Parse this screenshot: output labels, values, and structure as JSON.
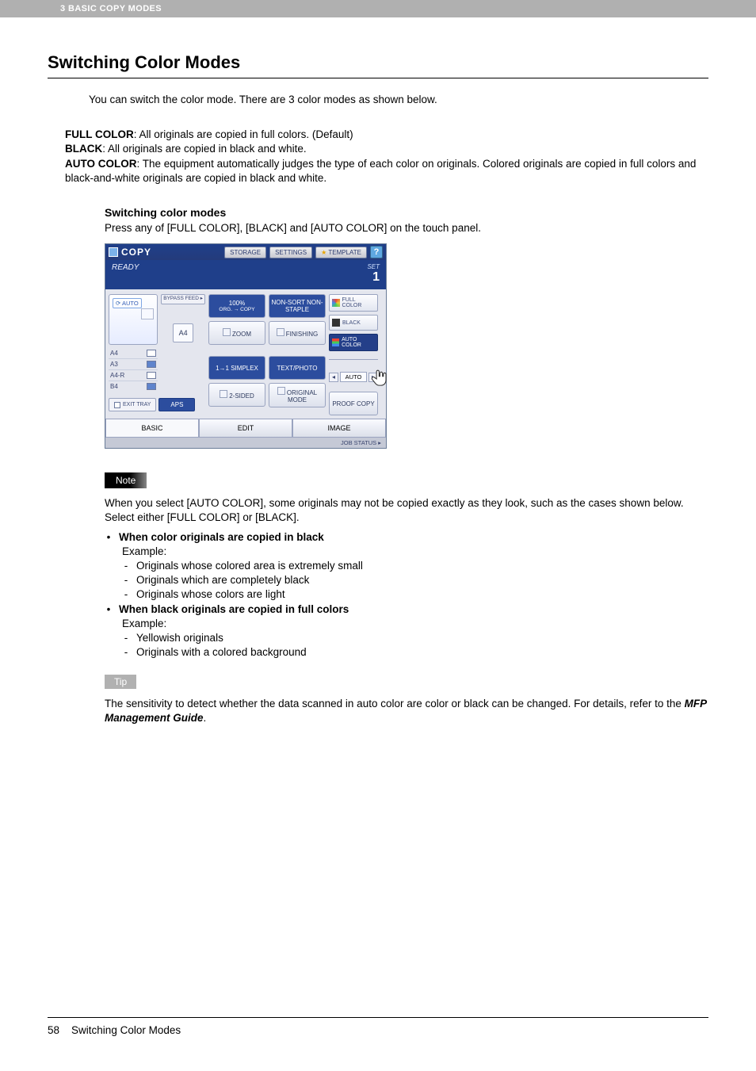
{
  "header": {
    "chapter": "3 BASIC COPY MODES"
  },
  "title": "Switching Color Modes",
  "intro": "You can switch the color mode. There are 3 color modes as shown below.",
  "modes": {
    "full_color_label": "FULL COLOR",
    "full_color_text": ": All originals are copied in full colors. (Default)",
    "black_label": "BLACK",
    "black_text": ": All originals are copied in black and white.",
    "auto_color_label": "AUTO COLOR",
    "auto_color_text": ": The equipment automatically judges the type of each color on originals. Colored originals are copied in full colors and black-and-white originals are copied in black and white."
  },
  "sub_heading": "Switching color modes",
  "sub_text": "Press any of [FULL COLOR], [BLACK] and [AUTO COLOR] on the touch panel.",
  "screenshot": {
    "title": "COPY",
    "btn_storage": "STORAGE",
    "btn_settings": "SETTINGS",
    "btn_template": "TEMPLATE",
    "help": "?",
    "ready": "READY",
    "set_label": "SET",
    "set_value": "1",
    "auto_tag": "AUTO",
    "bypass": "BYPASS FEED ▸",
    "papers": [
      "A4",
      "A3",
      "A4-R",
      "B4"
    ],
    "a4_big": "A4",
    "exit_tray": "EXIT TRAY",
    "aps": "APS",
    "box1_top": "100%",
    "box1_sub": "ORG. → COPY",
    "box1_btn": "ZOOM",
    "box2_top": "NON-SORT NON-STAPLE",
    "box2_btn": "FINISHING",
    "box3_top": "1→1 SIMPLEX",
    "box3_btn": "2-SIDED",
    "box4_top": "TEXT/PHOTO",
    "box4_btn": "ORIGINAL MODE",
    "r_full": "FULL COLOR",
    "r_black": "BLACK",
    "r_auto": "AUTO COLOR",
    "arrow_label": "AUTO",
    "proof": "PROOF COPY",
    "tab_basic": "BASIC",
    "tab_edit": "EDIT",
    "tab_image": "IMAGE",
    "job_status": "JOB STATUS ▸"
  },
  "note_label": "Note",
  "note_intro": "When you select [AUTO COLOR], some originals may not be copied exactly as they look, such as the cases shown below. Select either [FULL COLOR] or [BLACK].",
  "note_case1_head": "When color originals are copied in black",
  "example_label": "Example:",
  "note_case1_items": [
    "Originals whose colored area is extremely small",
    "Originals which are completely black",
    "Originals whose colors are light"
  ],
  "note_case2_head": "When black originals are copied in full colors",
  "note_case2_items": [
    "Yellowish originals",
    "Originals with a colored background"
  ],
  "tip_label": "Tip",
  "tip_text_pre": "The sensitivity to detect whether the data scanned in auto color are color or black can be changed. For details, refer to the ",
  "tip_text_em": "MFP Management Guide",
  "tip_text_post": ".",
  "footer": {
    "page": "58",
    "title": "Switching Color Modes"
  }
}
